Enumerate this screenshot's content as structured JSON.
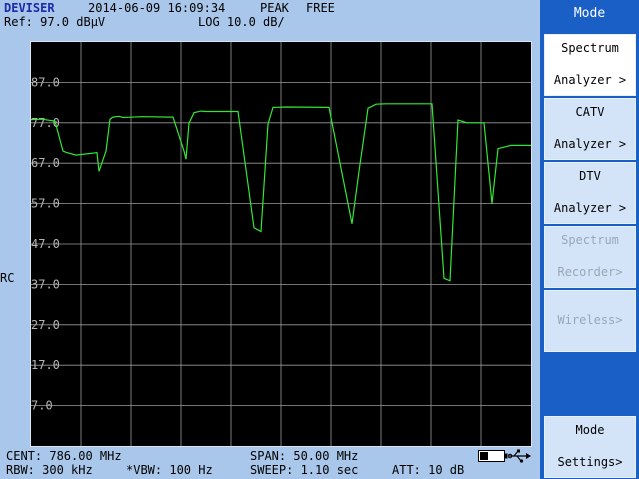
{
  "header": {
    "brand": "DEVISER",
    "datetime": "2014-06-09 16:09:34",
    "detector": "PEAK",
    "trigger": "FREE",
    "ref_level": "Ref: 97.0 dBμV",
    "scale": "LOG 10.0 dB/"
  },
  "side_label": "RC",
  "graph": {
    "y_ticks": [
      "87.0",
      "77.0",
      "67.0",
      "57.0",
      "47.0",
      "37.0",
      "27.0",
      "17.0",
      "7.0"
    ],
    "trace_color": "#33e833",
    "grid_color": "#9a9a9a"
  },
  "chart_data": {
    "type": "line",
    "ylabel": "dBμV",
    "ylim": [
      -3,
      97
    ],
    "xlim": [
      761,
      811
    ],
    "x_unit": "MHz",
    "series": [
      {
        "x": [
          761.0,
          762.1,
          763.4,
          764.2,
          764.5,
          765.5,
          767.6,
          767.8,
          768.5,
          768.9,
          769.2,
          769.8,
          770.2,
          772.1,
          775.2,
          776.3,
          776.5,
          776.8,
          777.3,
          778.0,
          778.5,
          781.7,
          783.3,
          784.0,
          784.7,
          785.2,
          786.5,
          790.8,
          793.1,
          793.8,
          794.7,
          795.5,
          796.5,
          801.1,
          802.3,
          802.9,
          803.7,
          804.6,
          805.7,
          806.3,
          807.1,
          807.7,
          809.0,
          811.0
        ],
        "y": [
          77.8,
          77.9,
          77.4,
          70.0,
          69.7,
          69.0,
          69.6,
          65.0,
          70.0,
          77.9,
          78.4,
          78.6,
          78.3,
          78.5,
          78.4,
          70.0,
          68.0,
          76.9,
          79.5,
          79.9,
          79.8,
          79.8,
          51.0,
          50.1,
          76.7,
          80.8,
          80.9,
          80.8,
          52.0,
          65.0,
          80.6,
          81.6,
          81.7,
          81.7,
          38.5,
          37.9,
          77.7,
          77.0,
          77.0,
          77.0,
          57.0,
          70.6,
          71.4,
          71.4
        ]
      }
    ]
  },
  "status": {
    "cent": "CENT: 786.00 MHz",
    "span": "SPAN: 50.00 MHz",
    "rbw": "RBW: 300 kHz",
    "vbw": "*VBW: 100 Hz",
    "sweep": "SWEEP: 1.10 sec",
    "att": "ATT: 10 dB",
    "battery_level": 0.35
  },
  "menu": {
    "title": "Mode",
    "keys": [
      {
        "line1": "Spectrum",
        "line2": "Analyzer >"
      },
      {
        "line1": "CATV",
        "line2": "Analyzer >"
      },
      {
        "line1": "DTV",
        "line2": "Analyzer >"
      },
      {
        "line1": "Spectrum",
        "line2": "Recorder>"
      },
      {
        "label": "Wireless>"
      },
      {
        "line1": "Mode",
        "line2": "Settings>"
      }
    ]
  }
}
